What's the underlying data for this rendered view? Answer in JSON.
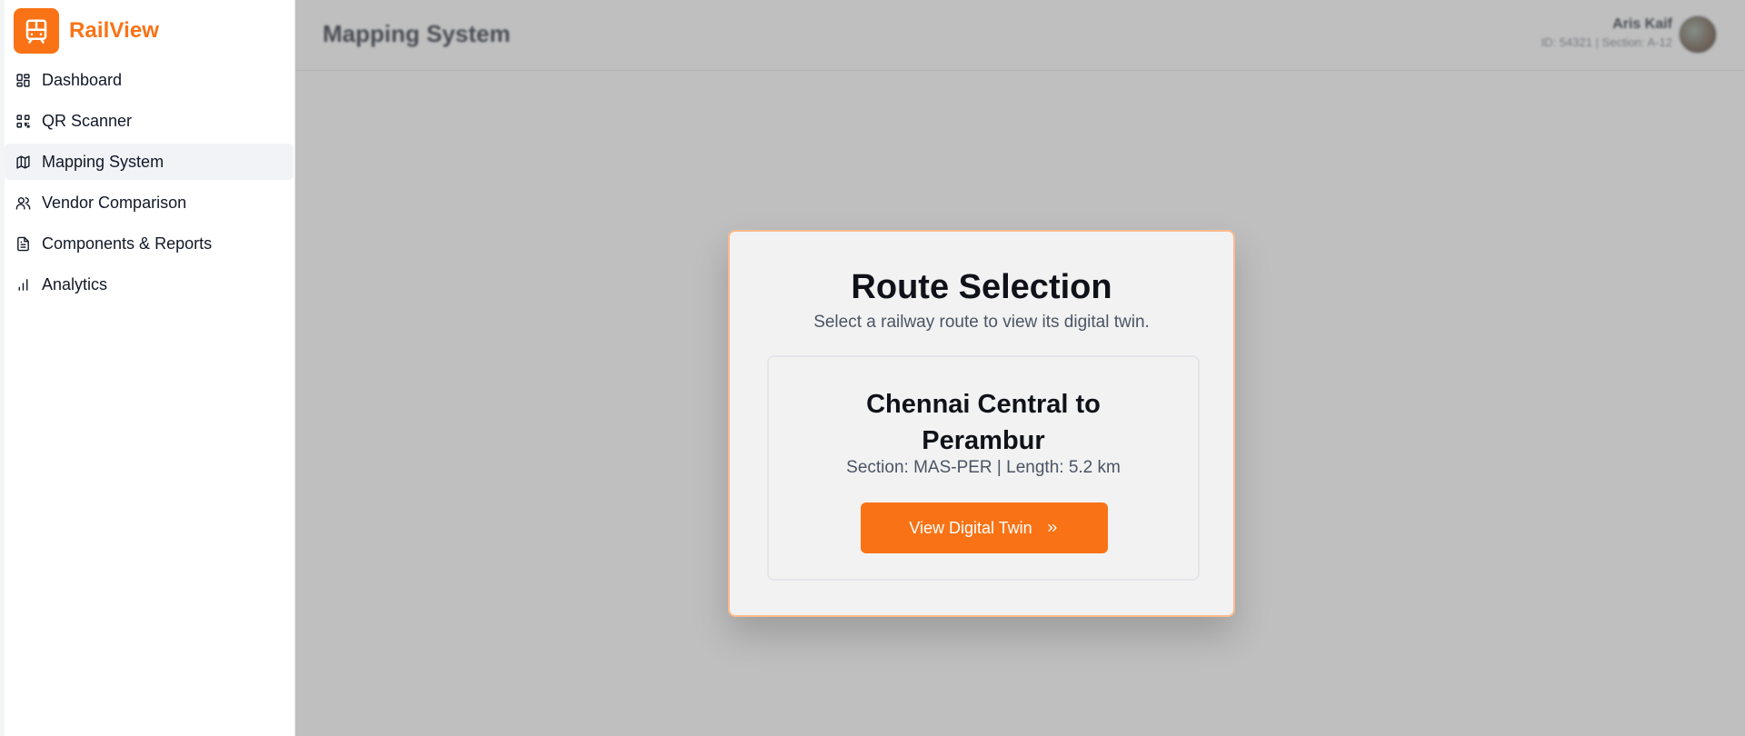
{
  "app": {
    "name": "RailView",
    "accent": "#f97316"
  },
  "sidebar": {
    "items": [
      {
        "label": "Dashboard",
        "icon": "dashboard-icon",
        "active": false
      },
      {
        "label": "QR Scanner",
        "icon": "qr-code-icon",
        "active": false
      },
      {
        "label": "Mapping System",
        "icon": "map-icon",
        "active": true
      },
      {
        "label": "Vendor Comparison",
        "icon": "users-icon",
        "active": false
      },
      {
        "label": "Components & Reports",
        "icon": "document-icon",
        "active": false
      },
      {
        "label": "Analytics",
        "icon": "bar-chart-icon",
        "active": false
      }
    ]
  },
  "header": {
    "title": "Mapping System",
    "user": {
      "name": "Aris Kaif",
      "meta": "ID: 54321 | Section: A-12"
    }
  },
  "modal": {
    "title": "Route Selection",
    "subtitle": "Select a railway route to view its digital twin.",
    "route": {
      "name": "Chennai Central to Perambur",
      "meta": "Section: MAS-PER | Length: 5.2 km",
      "button_label": "View Digital Twin",
      "button_icon": "chevrons-right-icon"
    }
  }
}
